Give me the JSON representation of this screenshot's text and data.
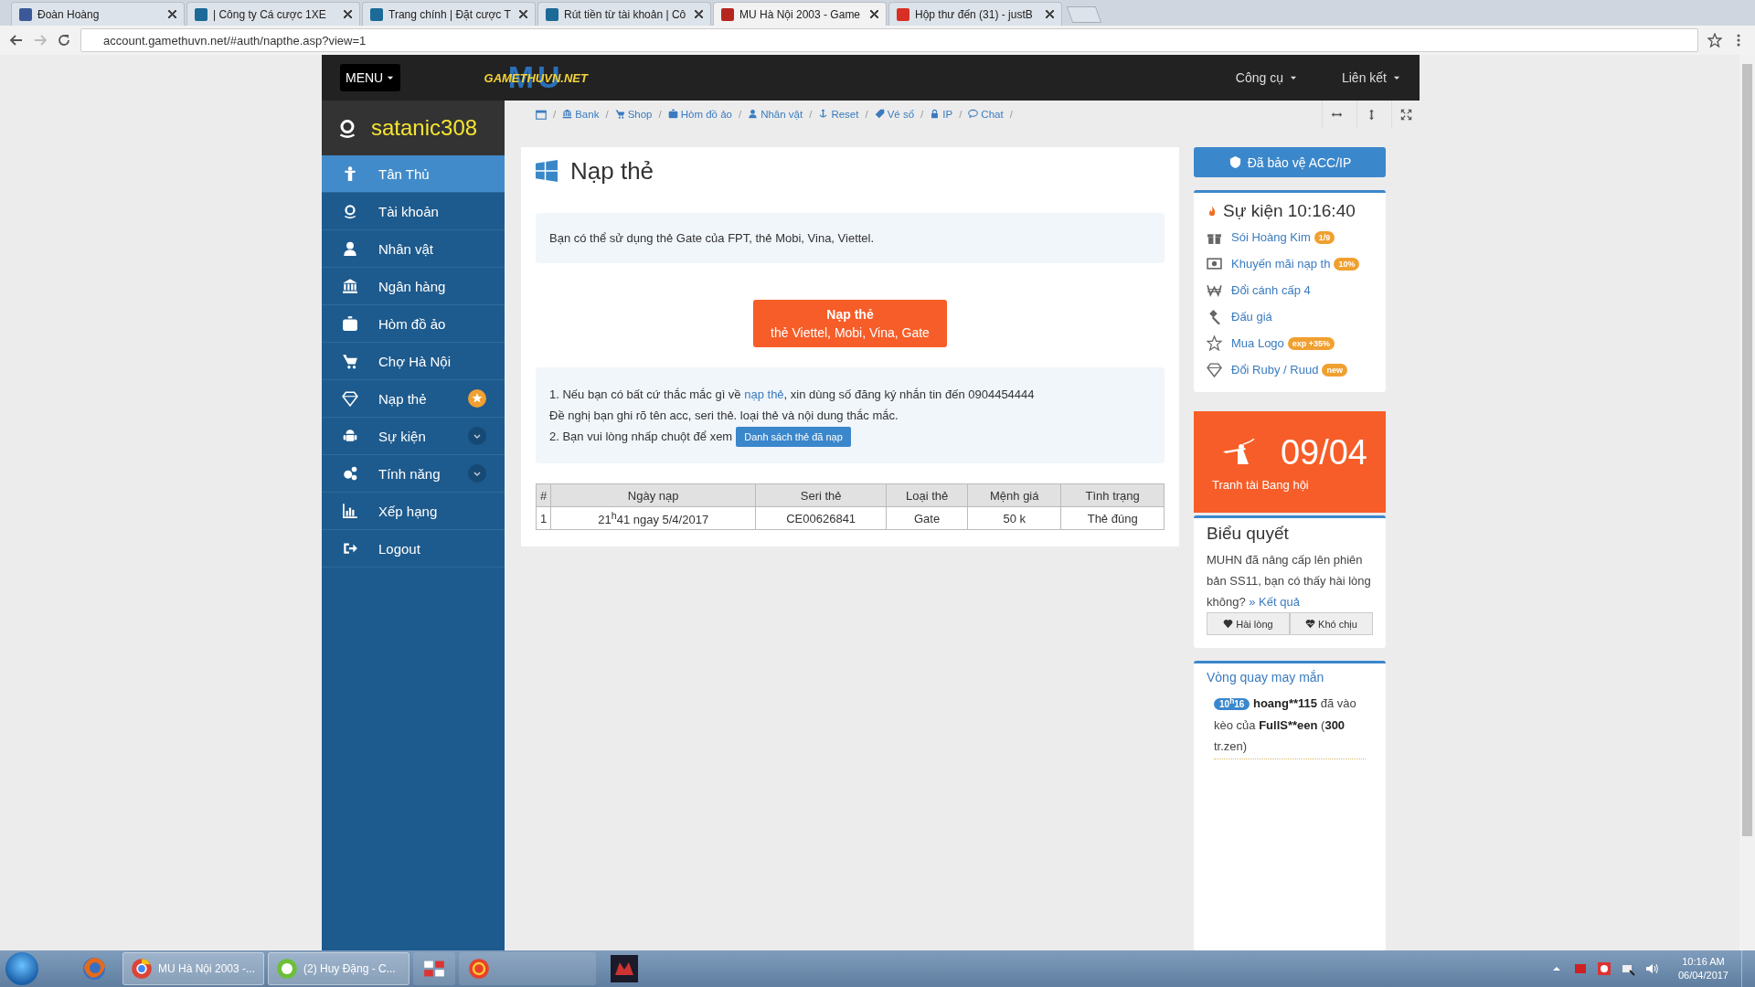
{
  "browser": {
    "tabs": [
      {
        "title": "Đoàn Hoàng",
        "selected": false
      },
      {
        "title": "| Công ty Cá cược 1XE",
        "selected": false
      },
      {
        "title": "Trang chính | Đặt cược T",
        "selected": false
      },
      {
        "title": "Rút tiền từ tài khoản | Cô",
        "selected": false
      },
      {
        "title": "MU Hà Nội 2003 - Game",
        "selected": true
      },
      {
        "title": "Hộp thư đến (31) - justB",
        "selected": false
      }
    ],
    "url": "account.gamethuvn.net/#auth/napthe.asp?view=1"
  },
  "topbar": {
    "menu": "MENU",
    "logo_big": "MU",
    "logo_small": "GAMETHUVN.NET",
    "links": [
      "Công cụ",
      "Liên kết"
    ]
  },
  "sidebar": {
    "username": "satanic308",
    "items": [
      {
        "label": "Tân Thủ",
        "selected": true,
        "kind": "plain"
      },
      {
        "label": "Tài khoản",
        "selected": false,
        "kind": "plain"
      },
      {
        "label": "Nhân vật",
        "selected": false,
        "kind": "plain"
      },
      {
        "label": "Ngân hàng",
        "selected": false,
        "kind": "plain"
      },
      {
        "label": "Hòm đồ ảo",
        "selected": false,
        "kind": "plain"
      },
      {
        "label": "Chợ Hà Nội",
        "selected": false,
        "kind": "plain"
      },
      {
        "label": "Nạp thẻ",
        "selected": false,
        "kind": "star"
      },
      {
        "label": "Sự kiện",
        "selected": false,
        "kind": "dropdown"
      },
      {
        "label": "Tính năng",
        "selected": false,
        "kind": "dropdown"
      },
      {
        "label": "Xếp hạng",
        "selected": false,
        "kind": "plain"
      },
      {
        "label": "Logout",
        "selected": false,
        "kind": "plain"
      }
    ]
  },
  "breadcrumb": {
    "separator": "/",
    "items": [
      "Bank",
      "Shop",
      "Hòm đồ ảo",
      "Nhân vật",
      "Reset",
      "Vé số",
      "IP",
      "Chat"
    ]
  },
  "main": {
    "title": "Nạp thẻ",
    "intro": "Bạn có thể sử dụng thẻ Gate của FPT, thẻ Mobi, Vina, Viettel.",
    "button": {
      "title": "Nạp thẻ",
      "subtitle": "thẻ Viettel, Mobi, Vina, Gate"
    },
    "notes": {
      "line1_before": "1. Nếu bạn có bất cứ thắc mắc gì về ",
      "link": "nạp thẻ",
      "line1_after": ", xin dùng số đăng ký nhắn tin đến 0904454444",
      "line2": "Đề nghị bạn ghi rõ tên acc, seri thẻ. loại thẻ và nội dung thắc mắc.",
      "line3": "2. Bạn vui lòng nhấp chuột để xem",
      "button": "Danh sách thẻ đã nạp"
    },
    "table": {
      "columns": [
        "#",
        "Ngày nạp",
        "Seri thẻ",
        "Loại thẻ",
        "Mệnh giá",
        "Tình trạng"
      ],
      "rows": [
        [
          "1",
          "21$^{h}$41 ngay 5/4/2017",
          "CE00626841",
          "Gate",
          "50 k",
          "Thẻ đúng"
        ]
      ]
    }
  },
  "right": {
    "protect_button": "Đã bảo vệ ACC/IP",
    "events": {
      "title": "Sự kiện 10:16:40",
      "items": [
        {
          "label": "Sói Hoàng Kim",
          "badge": "1/9"
        },
        {
          "label": "Khuyến mãi nạp th",
          "badge": "10%"
        },
        {
          "label": "Đổi cánh cấp 4"
        },
        {
          "label": "Đấu giá"
        },
        {
          "label": "Mua Logo",
          "badge": "exp +35%"
        },
        {
          "label": "Đổi Ruby / Ruud",
          "badge": "new"
        }
      ]
    },
    "promo": {
      "date": "09/04",
      "caption": "Tranh tài Bang hội"
    },
    "vote": {
      "title": "Biểu quyết",
      "question": "MUHN đã nâng cấp lên phiên bản SS11, bạn có thấy hài lòng không?",
      "result_link": "» Kết quả",
      "buttons": [
        "Hài lòng",
        "Khó chịu"
      ]
    },
    "wheel": {
      "title": "Vòng quay may mắn",
      "time": "10$^{h}$16",
      "parts": [
        {
          "text": "hoang**115",
          "bold": true
        },
        {
          "text": " đã vào kèo của ",
          "bold": false
        },
        {
          "text": "FullS**een",
          "bold": true
        },
        {
          "text": " (",
          "bold": false
        },
        {
          "text": "300",
          "bold": true
        },
        {
          "text": " tr.zen)",
          "bold": false
        }
      ]
    }
  },
  "taskbar": {
    "tasks": [
      "MU Hà Nội 2003 -...",
      "(2) Huy Đặng - C..."
    ],
    "time": "10:16 AM",
    "date": "06/04/2017"
  }
}
